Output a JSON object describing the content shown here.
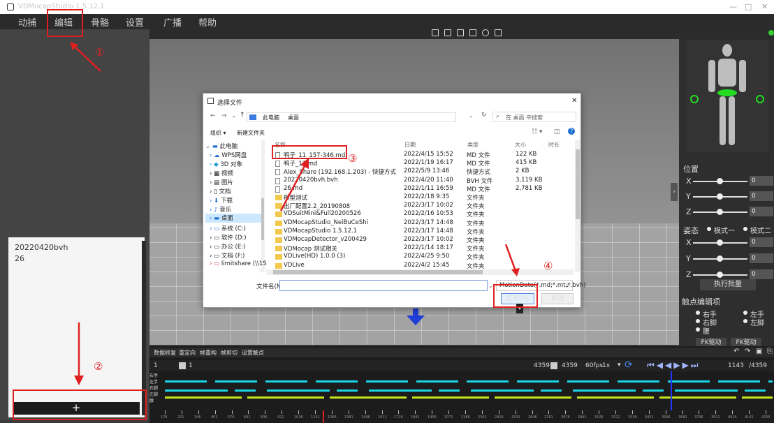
{
  "window": {
    "title": "VDMocapStudio 1.5.12.1",
    "min": "—",
    "max": "□",
    "close": "✕"
  },
  "menu": [
    "动捕",
    "编辑",
    "骨骼",
    "设置",
    "广播",
    "帮助"
  ],
  "left_panel": {
    "files": [
      "20220420bvh",
      "26"
    ],
    "add_label": "+"
  },
  "right_panel": {
    "position_label": "位置",
    "pose_label": "姿态",
    "mode1": "模式一",
    "mode2": "模式二",
    "axes": [
      "X",
      "Y",
      "Z"
    ],
    "position_values": [
      "0",
      "0",
      "0"
    ],
    "pose_values": [
      "0",
      "0",
      "0"
    ],
    "batch_button": "执行批量",
    "contact_label": "触点编辑项",
    "contacts": [
      "右手",
      "左手",
      "右脚",
      "左脚",
      "腰"
    ],
    "fk_button_1": "FK驱动",
    "fk_button_2": "FK驱动"
  },
  "timeline": {
    "tools": [
      "数据修复",
      "重定向",
      "帧重构",
      "帧剪切",
      "设置触点"
    ],
    "frame_start": "1",
    "frame_total": "4359",
    "frame_end": "4359",
    "fps": "60fps",
    "speed": "1x",
    "current_frame": "1143",
    "total_label": "/4359",
    "track_labels": [
      "右手",
      "左手",
      "右脚",
      "左脚",
      "腰"
    ],
    "ruler": [
      "176",
      "231",
      "346",
      "461",
      "576",
      "691",
      "806",
      "921",
      "1036",
      "1151",
      "1266",
      "1381",
      "1496",
      "1611",
      "1726",
      "1841",
      "1956",
      "2071",
      "2186",
      "2301",
      "2416",
      "2531",
      "2646",
      "2761",
      "2876",
      "2991",
      "3106",
      "3221",
      "3336",
      "3451",
      "3566",
      "3681",
      "3796",
      "3911",
      "4026",
      "4141",
      "4256"
    ]
  },
  "dialog": {
    "title": "选择文件",
    "close": "✕",
    "breadcrumb": [
      "此电脑",
      "桌面"
    ],
    "search_placeholder": "在 桌面 中搜索",
    "organize": "组织 ▾",
    "new_folder": "新建文件夹",
    "columns": [
      "名称",
      "日期",
      "类型",
      "大小",
      "时长"
    ],
    "nav": [
      "此电脑",
      "WPS网盘",
      "3D 对象",
      "视频",
      "图片",
      "文档",
      "下载",
      "音乐",
      "桌面",
      "系统 (C:)",
      "软件 (D:)",
      "办公 (E:)",
      "文档 (F:)",
      "limitshare (\\\\1S"
    ],
    "files": [
      {
        "name": "鸭子_11_157-346.md",
        "date": "2022/4/15 15:52",
        "type": "MD 文件",
        "size": "122 KB",
        "kind": "doc"
      },
      {
        "name": "鸭子_11.md",
        "date": "2022/1/19 16:17",
        "type": "MD 文件",
        "size": "415 KB",
        "kind": "doc"
      },
      {
        "name": "Alex_Share (192.168.1.203) - 快捷方式",
        "date": "2022/5/9 13:46",
        "type": "快捷方式",
        "size": "2 KB",
        "kind": "link"
      },
      {
        "name": "20220420bvh.bvh",
        "date": "2022/4/20 11:40",
        "type": "BVH 文件",
        "size": "3,119 KB",
        "kind": "doc"
      },
      {
        "name": "26.md",
        "date": "2022/1/11 16:59",
        "type": "MD 文件",
        "size": "2,781 KB",
        "kind": "doc"
      },
      {
        "name": "模型测试",
        "date": "2022/2/18 9:35",
        "type": "文件夹",
        "size": "",
        "kind": "folder"
      },
      {
        "name": "出厂配置2.2_20190808",
        "date": "2022/3/17 10:02",
        "type": "文件夹",
        "size": "",
        "kind": "folder"
      },
      {
        "name": "VDSuitMini&Full20200526",
        "date": "2022/2/16 10:53",
        "type": "文件夹",
        "size": "",
        "kind": "folder"
      },
      {
        "name": "VDMocapStudio_NeiBuCeShi",
        "date": "2022/3/17 14:48",
        "type": "文件夹",
        "size": "",
        "kind": "folder"
      },
      {
        "name": "VDMocapStudio 1.5.12.1",
        "date": "2022/3/17 14:48",
        "type": "文件夹",
        "size": "",
        "kind": "folder"
      },
      {
        "name": "VDMocapDetector_v200429",
        "date": "2022/3/17 10:02",
        "type": "文件夹",
        "size": "",
        "kind": "folder"
      },
      {
        "name": "VDMocap 测试相关",
        "date": "2022/1/14 18:17",
        "type": "文件夹",
        "size": "",
        "kind": "folder"
      },
      {
        "name": "VDLive(HD) 1.0.0 (3)",
        "date": "2022/4/25 9:50",
        "type": "文件夹",
        "size": "",
        "kind": "folder"
      },
      {
        "name": "VDLive",
        "date": "2022/4/2 15:45",
        "type": "文件夹",
        "size": "",
        "kind": "folder"
      }
    ],
    "filename_label": "文件名(N):",
    "filename_value": "",
    "filter": "MotionData(*.md;*.mt;*.bvh)",
    "open": "打开(O)",
    "cancel": "取消"
  },
  "annotations": [
    "①",
    "②",
    "③",
    "④"
  ],
  "colors": {
    "accent_red": "#e02020",
    "track_cyan": "#18d6e6",
    "track_yellow": "#c6e51a",
    "selection_blue": "#cce8ff"
  }
}
